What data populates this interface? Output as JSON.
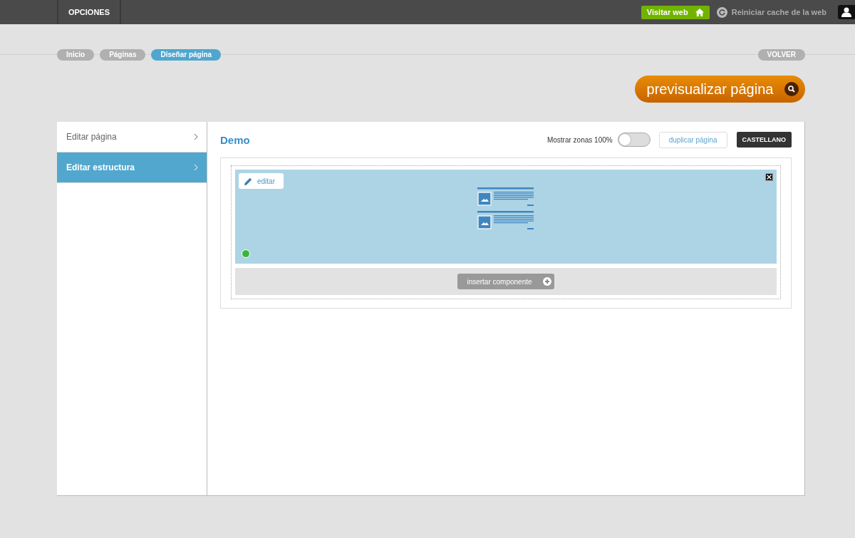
{
  "topbar": {
    "menu": "OPCIONES",
    "visit_button": "Visitar web",
    "cache_link": "Reiniciar cache de la web"
  },
  "breadcrumbs": [
    {
      "label": "Inicio",
      "selected": false
    },
    {
      "label": "Páginas",
      "selected": false
    },
    {
      "label": "Diseñar página",
      "selected": true
    }
  ],
  "back_button": "VOLVER",
  "preview_button": "previsualizar página",
  "sidebar": {
    "items": [
      {
        "label": "Editar página",
        "selected": false
      },
      {
        "label": "Editar estructura",
        "selected": true
      }
    ]
  },
  "editor": {
    "title": "Demo",
    "zones_toggle": {
      "label": "Mostrar zonas 100%",
      "on": false
    },
    "duplicate_button": "duplicar página",
    "language_button": "CASTELLANO",
    "zone": {
      "edit_button": "editar",
      "insert_button": "insertar componente"
    }
  }
}
